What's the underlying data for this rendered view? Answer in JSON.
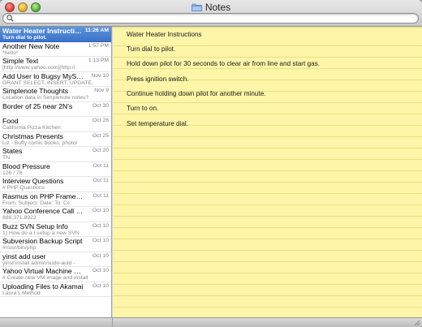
{
  "window": {
    "title": "Notes",
    "search_placeholder": "",
    "colors": {
      "selection": "#3a73c9",
      "paper": "#fdf5a8",
      "rule_line": "#ece07f"
    }
  },
  "notes_list": [
    {
      "title": "Water Heater Instructions",
      "preview": "Turn dial to pilot.",
      "date": "11:26 AM",
      "selected": true
    },
    {
      "title": "Another New Note",
      "preview": "*hello*",
      "date": "1:57 PM"
    },
    {
      "title": "Simple Text",
      "preview": "[http://www.yahoo.com](http://",
      "date": "1:13 PM"
    },
    {
      "title": "Add User to Bugsy MySQL…",
      "preview": "GRANT SELECT, INSERT, UPDATE,",
      "date": "Nov 10"
    },
    {
      "title": "Simplenote Thoughts",
      "preview": "Location data in Simplenote notes?",
      "date": "Nov 9"
    },
    {
      "title": "Border of 25 near 2N's",
      "preview": "",
      "date": "Oct 30"
    },
    {
      "title": "Food",
      "preview": "California Pizza Kitchen",
      "date": "Oct 26"
    },
    {
      "title": "Christmas Presents",
      "preview": "Liz - Buffy comic books, photo/",
      "date": "Oct 25"
    },
    {
      "title": "States",
      "preview": "TN",
      "date": "Oct 20"
    },
    {
      "title": "Blood Pressure",
      "preview": "126 / 78",
      "date": "Oct 11"
    },
    {
      "title": "Interview Questions",
      "preview": "# PHP Questions",
      "date": "Oct 11"
    },
    {
      "title": "Rasmus on PHP Framewor…",
      "preview": "From: Subject: Date: To: Cc:",
      "date": "Oct 11"
    },
    {
      "title": "Yahoo Conference Call Info",
      "preview": "888.371.8922",
      "date": "Oct 10"
    },
    {
      "title": "Buzz SVN Setup Info",
      "preview": "1) How do a I setup a new SVN",
      "date": "Oct 10"
    },
    {
      "title": "Subversion Backup Script",
      "preview": "#!/usr/bin/php",
      "date": "Oct 10"
    },
    {
      "title": "yinst add user",
      "preview": "yinst install admin/sudo-auld -",
      "date": "Oct 10"
    },
    {
      "title": "Yahoo Virtual Machine Setup",
      "preview": "# Create new VM image and install",
      "date": "Oct 10"
    },
    {
      "title": "Uploading Files to Akamai",
      "preview": "Laura's Method",
      "date": "Oct 10"
    }
  ],
  "note_body": [
    "Water Heater Instructions",
    "Turn dial to pilot.",
    "Hold down pilot for 30 seconds to clear air from line and start gas.",
    "Press ignition switch.",
    "Continue holding down pilot for another minute.",
    "Turn to on.",
    "Set temperature dial."
  ]
}
